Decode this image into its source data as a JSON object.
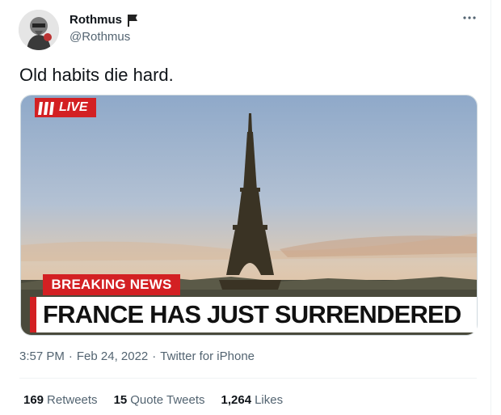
{
  "author": {
    "name": "Rothmus",
    "handle": "@Rothmus",
    "flag_icon": "black-flag-icon"
  },
  "tweet": {
    "text": "Old habits die hard.",
    "time": "3:57 PM",
    "date": "Feb 24, 2022",
    "source": "Twitter for iPhone",
    "separator": "·"
  },
  "media": {
    "live_label": "LIVE",
    "breaking_label": "BREAKING NEWS",
    "headline": "FRANCE HAS JUST SURRENDERED"
  },
  "stats": {
    "retweets_count": "169",
    "retweets_label": "Retweets",
    "quotes_count": "15",
    "quotes_label": "Quote Tweets",
    "likes_count": "1,264",
    "likes_label": "Likes"
  },
  "colors": {
    "breaking_red": "#d32023",
    "secondary_text": "#536471"
  }
}
